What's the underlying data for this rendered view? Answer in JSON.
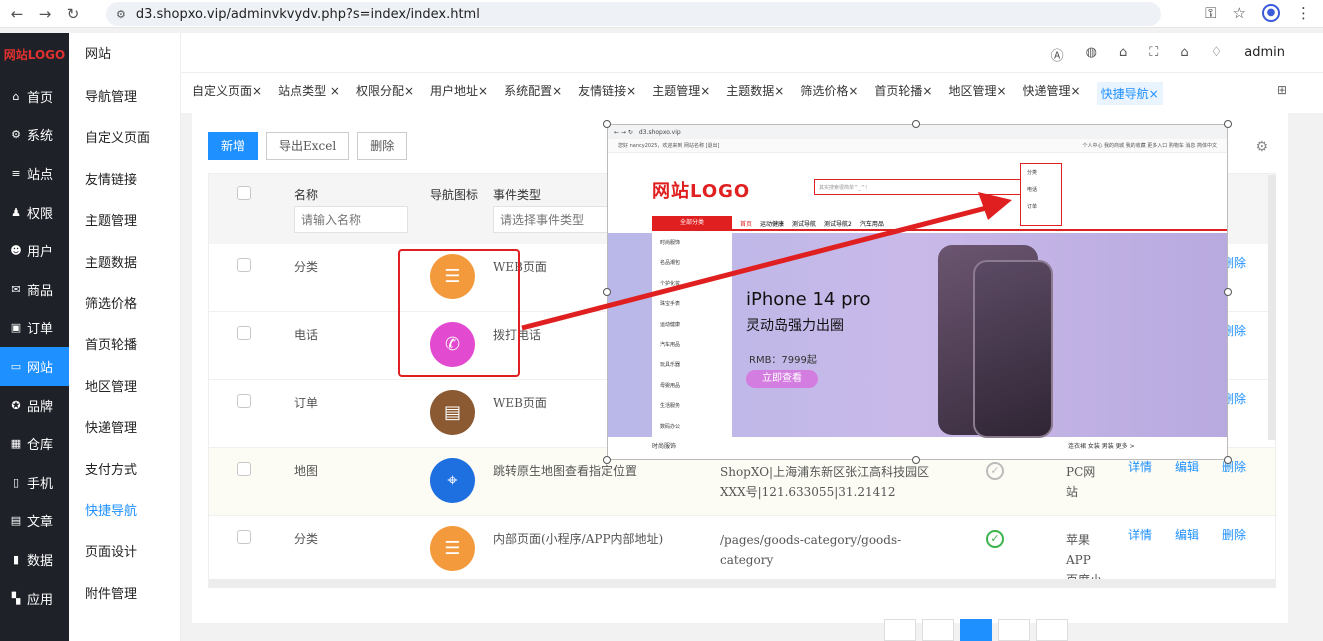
{
  "browser": {
    "url": "d3.shopxo.vip/adminvkvydv.php?s=index/index.html"
  },
  "sidebar": {
    "logo": "网站LOGO",
    "items": [
      {
        "icon": "home-icon",
        "glyph": "⌂",
        "label": "首页"
      },
      {
        "icon": "gear-icon",
        "glyph": "⚙",
        "label": "系统"
      },
      {
        "icon": "sliders-icon",
        "glyph": "≡",
        "label": "站点"
      },
      {
        "icon": "user-lock-icon",
        "glyph": "♟",
        "label": "权限"
      },
      {
        "icon": "user-icon",
        "glyph": "☻",
        "label": "用户"
      },
      {
        "icon": "goods-icon",
        "glyph": "✉",
        "label": "商品"
      },
      {
        "icon": "order-icon",
        "glyph": "▣",
        "label": "订单"
      },
      {
        "icon": "website-icon",
        "glyph": "▭",
        "label": "网站"
      },
      {
        "icon": "brand-icon",
        "glyph": "✪",
        "label": "品牌"
      },
      {
        "icon": "warehouse-icon",
        "glyph": "▦",
        "label": "仓库"
      },
      {
        "icon": "phone-icon",
        "glyph": "▯",
        "label": "手机"
      },
      {
        "icon": "article-icon",
        "glyph": "▤",
        "label": "文章"
      },
      {
        "icon": "data-icon",
        "glyph": "▮",
        "label": "数据"
      },
      {
        "icon": "apps-icon",
        "glyph": "▚",
        "label": "应用"
      }
    ]
  },
  "subbar": {
    "head": "网站",
    "items": [
      "导航管理",
      "自定义页面",
      "友情链接",
      "主题管理",
      "主题数据",
      "筛选价格",
      "首页轮播",
      "地区管理",
      "快递管理",
      "支付方式",
      "快捷导航",
      "页面设计",
      "附件管理"
    ]
  },
  "topbar": {
    "user": "admin"
  },
  "tabs": [
    "自定义页面×",
    "站点类型 ×",
    "权限分配×",
    "用户地址×",
    "系统配置×",
    "友情链接×",
    "主题管理×",
    "主题数据×",
    "筛选价格×",
    "首页轮播×",
    "地区管理×",
    "快递管理×",
    "快捷导航×"
  ],
  "toolbar": {
    "add_label": "新增",
    "export_label": "导出Excel",
    "delete_label": "删除"
  },
  "table": {
    "headers": {
      "name": "名称",
      "icon": "导航图标",
      "event_type": "事件类型"
    },
    "filters": {
      "name_placeholder": "请输入名称",
      "event_placeholder": "请选择事件类型"
    },
    "rows": [
      {
        "name": "分类",
        "icon": "category-list-icon",
        "color": "#f39a3c",
        "event": "WEB页面",
        "value": "",
        "platform": ""
      },
      {
        "name": "电话",
        "icon": "phone-call-icon",
        "color": "#e24bd0",
        "event": "拨打电话",
        "value": "",
        "platform": ""
      },
      {
        "name": "订单",
        "icon": "clipboard-icon",
        "color": "#8b5a32",
        "event": "WEB页面",
        "value": "",
        "platform": ""
      },
      {
        "name": "地图",
        "icon": "map-pin-icon",
        "color": "#1e6fe0",
        "event": "跳转原生地图查看指定位置",
        "value": "ShopXO|上海浦东新区张江高科技园区XXX号|121.633055|31.21412",
        "platform": "PC网站"
      },
      {
        "name": "分类",
        "icon": "category-list-icon",
        "color": "#f39a3c",
        "event": "内部页面(小程序/APP内部地址)",
        "value": "/pages/goods-category/goods-category",
        "platform": "苹果APP 百度小程"
      }
    ],
    "actions": {
      "detail": "详情",
      "edit": "编辑",
      "delete": "删除"
    }
  },
  "overlay": {
    "url": "d3.shopxo.vip",
    "top_left": "您好 nancy2025，欢迎来到 网站名称 [退出]",
    "top_right": "个人中心  我的商城  我的收藏  更多入口  购物车  消息  简体中文",
    "logo": "网站LOGO",
    "search_placeholder": "其实搜索很简单^_^！",
    "dropdown": [
      "分类",
      "电话",
      "订单"
    ],
    "all_categories": "全部分类",
    "nav_links": [
      "首页",
      "运动健康",
      "测试导航",
      "测试导航2",
      "汽车用品"
    ],
    "categories": [
      "时尚服饰",
      "名品潮包",
      "个护化妆",
      "珠宝手表",
      "运动健康",
      "汽车用品",
      "玩具乐器",
      "母婴用品",
      "生活服务",
      "数码办公"
    ],
    "banner_title": "iPhone 14 pro",
    "banner_sub": "灵动岛强力出圈",
    "banner_price": "RMB：7999起",
    "banner_button": "立即查看",
    "bottom_left": "时尚服饰",
    "bottom_right": "连衣裙  女装  男装  更多 >"
  },
  "colors": {
    "accent": "#1e90ff",
    "highlight": "#e02020",
    "sidebar_bg": "#1e2128"
  }
}
